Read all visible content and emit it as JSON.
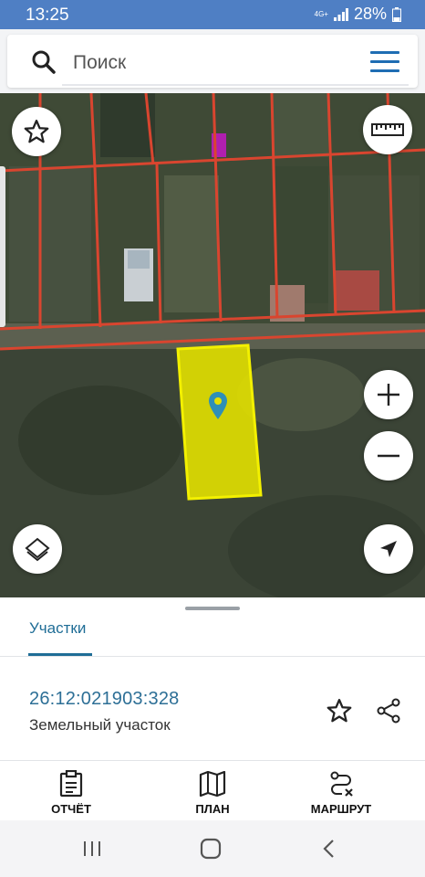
{
  "status": {
    "time": "13:25",
    "network": "4G+",
    "battery": "28%"
  },
  "search": {
    "placeholder": "Поиск"
  },
  "map": {
    "buttons": {
      "favorite": "star-icon",
      "ruler": "ruler-icon",
      "zoom_in": "plus-icon",
      "zoom_out": "minus-icon",
      "layers": "layers-icon",
      "locate": "navigation-arrow-icon"
    },
    "colors": {
      "boundary": "#d9452f",
      "selected_parcel": "#e8e600",
      "marker": "#2f8fb6"
    }
  },
  "sheet": {
    "tab": "Участки",
    "parcel": {
      "cadastral_number": "26:12:021903:328",
      "type": "Земельный участок"
    }
  },
  "nav": {
    "report": "ОТЧЁТ",
    "plan": "ПЛАН",
    "route": "МАРШРУТ"
  },
  "accent": "#1f6d96"
}
